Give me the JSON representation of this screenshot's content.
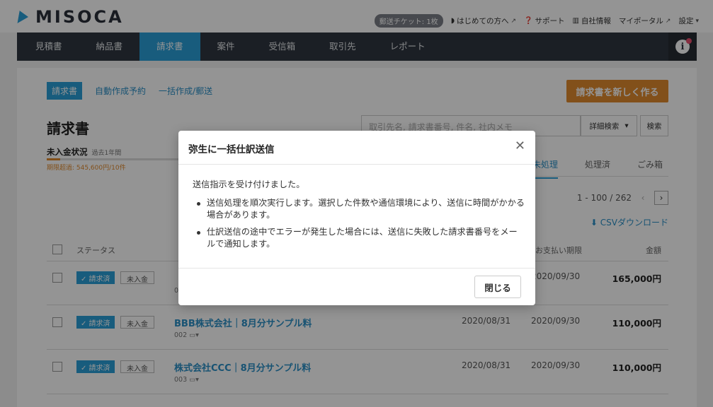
{
  "brand": {
    "logo_text": "MISOCA"
  },
  "toplinks": {
    "ticket": "郵送チケット: 1枚",
    "beginners": "はじめての方へ",
    "support": "サポート",
    "company": "自社情報",
    "myportal": "マイポータル",
    "settings": "設定"
  },
  "nav": {
    "items": [
      {
        "label": "見積書"
      },
      {
        "label": "納品書"
      },
      {
        "label": "請求書"
      },
      {
        "label": "案件"
      },
      {
        "label": "受信箱"
      },
      {
        "label": "取引先"
      },
      {
        "label": "レポート"
      }
    ]
  },
  "subtabs": {
    "invoice": "請求書",
    "auto": "自動作成予約",
    "bulk": "一括作成/郵送"
  },
  "new_button": "請求書を新しく作る",
  "page_title": "請求書",
  "search": {
    "placeholder": "取引先名, 請求書番号, 件名, 社内メモ",
    "detail": "詳細検索",
    "button": "検索"
  },
  "status": {
    "title": "未入金状況",
    "period": "過去1年間",
    "overdue": "期限超過: 545,600円/10件"
  },
  "view_tabs": {
    "unprocessed": "未処理",
    "processed": "処理済",
    "trash": "ごみ箱"
  },
  "pager": {
    "text": "1 - 100 / 262"
  },
  "csv": "CSVダウンロード",
  "table": {
    "headers": {
      "status": "ステータス",
      "due": "お支払い期限",
      "amount": "金額"
    },
    "rows": [
      {
        "badge": "✓ 請求済",
        "unpaid": "未入金",
        "title": "",
        "no": "001",
        "date": "",
        "due": "2020/09/30",
        "amount": "165,000円"
      },
      {
        "badge": "✓ 請求済",
        "unpaid": "未入金",
        "title": "BBB株式会社｜8月分サンプル料",
        "no": "002",
        "date": "2020/08/31",
        "due": "2020/09/30",
        "amount": "110,000円"
      },
      {
        "badge": "✓ 請求済",
        "unpaid": "未入金",
        "title": "株式会社CCC｜8月分サンプル料",
        "no": "003",
        "date": "2020/08/31",
        "due": "2020/09/30",
        "amount": "110,000円"
      }
    ]
  },
  "modal": {
    "title": "弥生に一括仕訳送信",
    "intro": "送信指示を受け付けました。",
    "bullets": [
      "送信処理を順次実行します。選択した件数や通信環境により、送信に時間がかかる場合があります。",
      "仕訳送信の途中でエラーが発生した場合には、送信に失敗した請求書番号をメールで通知します。"
    ],
    "close": "閉じる"
  }
}
